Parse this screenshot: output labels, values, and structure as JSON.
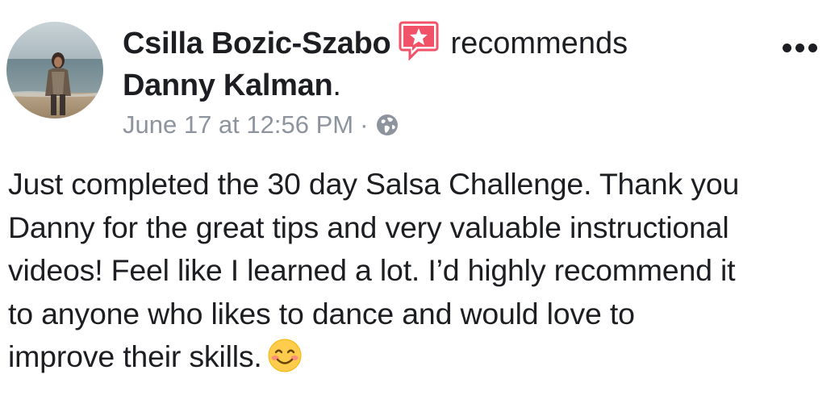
{
  "post": {
    "author": "Csilla Bozic-Szabo",
    "action": "recommends",
    "recommended_page": "Danny Kalman",
    "recommended_suffix": ".",
    "timestamp": "June 17 at 12:56 PM",
    "separator": "·",
    "privacy_icon": "globe-icon",
    "recommend_icon": "recommend-star-icon",
    "more_icon": "more-options-icon",
    "body_lines": [
      "Just completed the 30 day Salsa Challenge. Thank you",
      "Danny for the great tips and very valuable instructional",
      "videos! Feel like I learned a lot. I’d highly recommend it",
      "to anyone who likes to dance and would love to",
      "improve their skills."
    ],
    "emoji": "smiling-face-emoji"
  },
  "colors": {
    "text": "#1c1e21",
    "secondary_text": "#8d949e",
    "recommend_badge": "#f25268",
    "emoji_face": "#ffcc4d"
  }
}
